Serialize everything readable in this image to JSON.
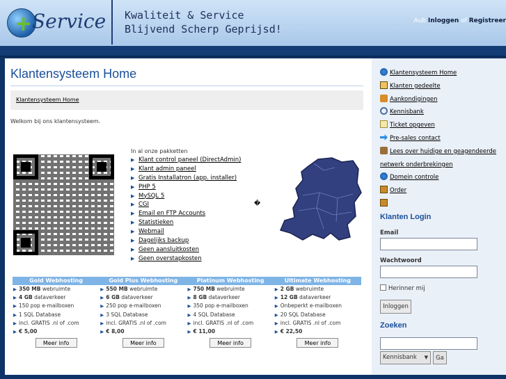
{
  "header": {
    "logo_text": "Service",
    "slogan_line1": "Kwaliteit & Service",
    "slogan_line2": "Blijvend Scherp Geprijsd!",
    "toplinks": {
      "prefix": "Aub ",
      "login": "Inloggen",
      "or": " of ",
      "register": "Registreer"
    }
  },
  "main": {
    "title": "Klantensysteem Home",
    "breadcrumb": "Klantensysteem Home",
    "welcome": "Welkom bij ons klantensysteem.",
    "features_intro": "In al onze pakketten",
    "features": [
      "Klant control paneel (DirectAdmin)",
      "Klant admin paneel",
      "Gratis Installatron (app. installer)",
      "PHP 5",
      "MySQL 5",
      "CGI",
      "Email en FTP Accounts",
      "Statistieken",
      "Webmail",
      "Dagelijks backup",
      "Geen aansluitkosten",
      "Geen overstapkosten"
    ],
    "question_mark": "�",
    "plans": [
      {
        "name": "Gold Webhosting",
        "space": "350 MB",
        "traffic": "4 GB",
        "mail": "150 pop e-mailboxen",
        "db": "1 SQL Database",
        "domain": "incl. GRATIS .nl of .com",
        "price": "€ 5,00",
        "button": "Meer info"
      },
      {
        "name": "Gold Plus Webhosting",
        "space": "550 MB",
        "traffic": "6 GB",
        "mail": "250 pop e-mailboxen",
        "db": "3 SQL Database",
        "domain": "incl. GRATIS .nl of .com",
        "price": "€ 8,00",
        "button": "Meer info"
      },
      {
        "name": "Platinum Webhosting",
        "space": "750 MB",
        "traffic": "8 GB",
        "mail": "350 pop e-mailboxen",
        "db": "4 SQL Database",
        "domain": "incl. GRATIS .nl of .com",
        "price": "€ 11,00",
        "button": "Meer info"
      },
      {
        "name": "Ultimate Webhosting",
        "space": "2 GB",
        "traffic": "12 GB",
        "mail": "Onbeperkt e-mailboxen",
        "db": "20 SQL Database",
        "domain": "incl. GRATIS .nl of .com",
        "price": "€ 22,50",
        "button": "Meer info"
      }
    ],
    "space_suffix": " webruimte",
    "traffic_suffix": " dataverkeer"
  },
  "sidebar": {
    "nav": [
      {
        "label": "Klantensysteem Home",
        "icon": "globe-icon"
      },
      {
        "label": "Klanten gedeelte",
        "icon": "house-icon"
      },
      {
        "label": "Aankondigingen",
        "icon": "announcement-icon"
      },
      {
        "label": "Kennisbank",
        "icon": "magnifier-icon"
      },
      {
        "label": "Ticket opgeven",
        "icon": "ticket-icon"
      },
      {
        "label": "Pre-sales contact",
        "icon": "arrow-icon"
      },
      {
        "label": "Lees over huidige en geagendeerde netwerk onderbrekingen",
        "icon": "network-icon"
      },
      {
        "label": "Domein controle",
        "icon": "globe-icon"
      },
      {
        "label": "Order",
        "icon": "box-icon"
      },
      {
        "label": "",
        "icon": "cart-icon"
      }
    ],
    "login_title": "Klanten Login",
    "email_label": "Email",
    "password_label": "Wachtwoord",
    "remember_label": "Herinner mij",
    "login_button": "Inloggen",
    "search_title": "Zoeken",
    "search_select": "Kennisbank",
    "search_button": "Ga"
  }
}
